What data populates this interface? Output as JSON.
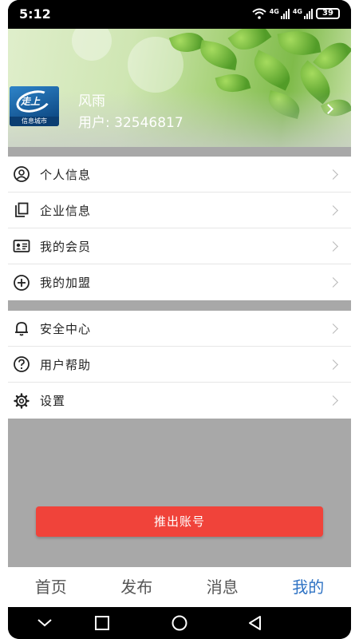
{
  "status_bar": {
    "time": "5:12",
    "signal_label_1": "4G",
    "signal_label_2": "4G",
    "battery": "39"
  },
  "profile": {
    "name": "风雨",
    "user_id": "用户: 32546817",
    "logo_mark": "走上",
    "logo_caption": "信息城市"
  },
  "menu_group_1": [
    {
      "label": "个人信息",
      "icon": "person-circle-icon"
    },
    {
      "label": "企业信息",
      "icon": "copy-icon"
    },
    {
      "label": "我的会员",
      "icon": "id-card-icon"
    },
    {
      "label": "我的加盟",
      "icon": "plus-circle-icon"
    }
  ],
  "menu_group_2": [
    {
      "label": "安全中心",
      "icon": "bell-icon"
    },
    {
      "label": "用户帮助",
      "icon": "help-circle-icon"
    },
    {
      "label": "设置",
      "icon": "gear-icon"
    }
  ],
  "logout_label": "推出账号",
  "tabs": [
    {
      "label": "首页",
      "active": false
    },
    {
      "label": "发布",
      "active": false
    },
    {
      "label": "消息",
      "active": false
    },
    {
      "label": "我的",
      "active": true
    }
  ],
  "colors": {
    "accent": "#2f73c4",
    "logout": "#f0433a",
    "content_bg": "#a8a8a8"
  }
}
